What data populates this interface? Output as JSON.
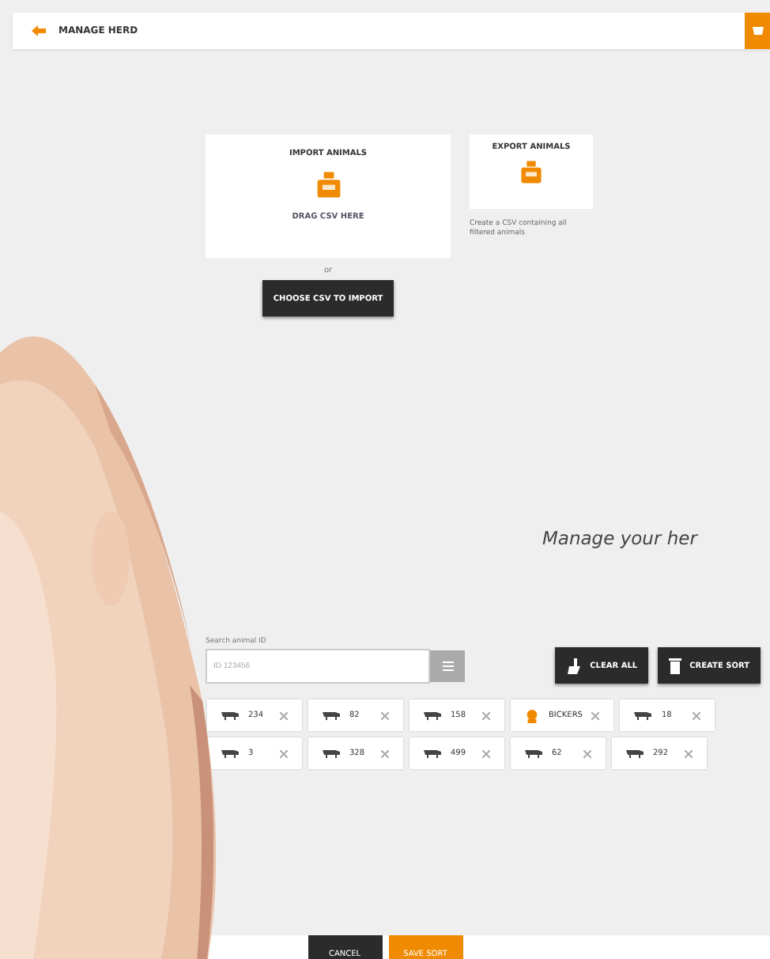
{
  "header": {
    "title": "MANAGE HERD"
  },
  "import": {
    "title": "IMPORT ANIMALS",
    "drop_text": "DRAG CSV HERE",
    "or": "or",
    "button": "CHOOSE CSV TO IMPORT"
  },
  "export": {
    "title": "EXPORT ANIMALS",
    "description": "Create a CSV containing all filtered animals"
  },
  "tagline": "Manage your her",
  "search": {
    "label": "Search animal ID",
    "placeholder": "ID 123456"
  },
  "actions": [
    {
      "kind": "clear",
      "label": "CLEAR ALL"
    },
    {
      "kind": "create",
      "label": "CREATE SORT"
    }
  ],
  "tags": [
    {
      "kind": "animal",
      "label": "234"
    },
    {
      "kind": "animal",
      "label": "82"
    },
    {
      "kind": "animal",
      "label": "158"
    },
    {
      "kind": "group",
      "label": "BICKERS"
    },
    {
      "kind": "animal",
      "label": "18"
    },
    {
      "kind": "animal",
      "label": "3"
    },
    {
      "kind": "animal",
      "label": "328"
    },
    {
      "kind": "animal",
      "label": "499"
    },
    {
      "kind": "animal",
      "label": "62"
    },
    {
      "kind": "animal",
      "label": "292"
    }
  ],
  "footer": {
    "cancel": "CANCEL",
    "save": "SAVE SORT"
  }
}
